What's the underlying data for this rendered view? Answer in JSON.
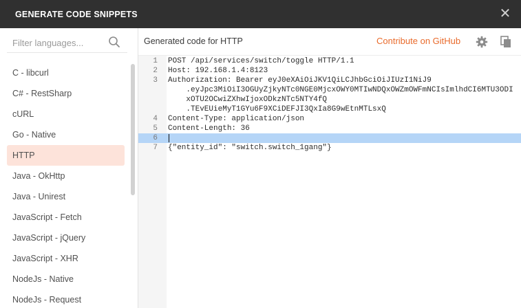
{
  "dialog": {
    "title": "GENERATE CODE SNIPPETS",
    "close_glyph": "✕"
  },
  "sidebar": {
    "search": {
      "placeholder": "Filter languages...",
      "value": ""
    },
    "items": [
      {
        "label": "C - libcurl",
        "selected": false
      },
      {
        "label": "C# - RestSharp",
        "selected": false
      },
      {
        "label": "cURL",
        "selected": false
      },
      {
        "label": "Go - Native",
        "selected": false
      },
      {
        "label": "HTTP",
        "selected": true
      },
      {
        "label": "Java - OkHttp",
        "selected": false
      },
      {
        "label": "Java - Unirest",
        "selected": false
      },
      {
        "label": "JavaScript - Fetch",
        "selected": false
      },
      {
        "label": "JavaScript - jQuery",
        "selected": false
      },
      {
        "label": "JavaScript - XHR",
        "selected": false
      },
      {
        "label": "NodeJs - Native",
        "selected": false
      },
      {
        "label": "NodeJs - Request",
        "selected": false
      }
    ]
  },
  "main": {
    "header_title": "Generated code for HTTP",
    "contribute_label": "Contribute on GitHub",
    "icons": {
      "settings": "gear-icon",
      "copy": "copy-icon"
    }
  },
  "code": {
    "active_line": 6,
    "lines": [
      {
        "num": "1",
        "text": "POST /api/services/switch/toggle HTTP/1.1"
      },
      {
        "num": "2",
        "text": "Host: 192.168.1.4:8123"
      },
      {
        "num": "3",
        "text": "Authorization: Bearer eyJ0eXAiOiJKV1QiLCJhbGciOiJIUzI1NiJ9"
      },
      {
        "num": "",
        "text": "    .eyJpc3MiOiI3OGUyZjkyNTc0NGE0MjcxOWY0MTIwNDQxOWZmOWFmNCIsImlhdCI6MTU3ODI"
      },
      {
        "num": "",
        "text": "    xOTU2OCwiZXhwIjoxODkzNTc5NTY4fQ"
      },
      {
        "num": "",
        "text": "    .TEvEUieMyT1GYu6F9XCiDEFJI3QxIa8G9wEtnMTLsxQ"
      },
      {
        "num": "4",
        "text": "Content-Type: application/json"
      },
      {
        "num": "5",
        "text": "Content-Length: 36"
      },
      {
        "num": "6",
        "text": ""
      },
      {
        "num": "7",
        "text": "{\"entity_id\": \"switch.switch_1gang\"}"
      }
    ]
  },
  "colors": {
    "titlebar": "#303030",
    "accent": "#e96b2c",
    "selected_bg": "#fde3da",
    "active_line": "#b5d5f7"
  }
}
